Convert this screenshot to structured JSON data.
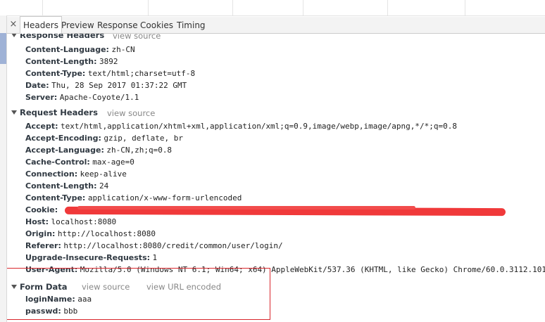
{
  "tabs": {
    "close": "×",
    "items": [
      "Headers",
      "Preview",
      "Response",
      "Cookies",
      "Timing"
    ],
    "active": "Headers"
  },
  "response_headers": {
    "title": "Response Headers",
    "view_source": "view source",
    "rows": [
      {
        "key": "Content-Language:",
        "value": "zh-CN"
      },
      {
        "key": "Content-Length:",
        "value": "3892"
      },
      {
        "key": "Content-Type:",
        "value": "text/html;charset=utf-8"
      },
      {
        "key": "Date:",
        "value": "Thu, 28 Sep 2017 01:37:22 GMT"
      },
      {
        "key": "Server:",
        "value": "Apache-Coyote/1.1"
      }
    ]
  },
  "request_headers": {
    "title": "Request Headers",
    "view_source": "view source",
    "rows": [
      {
        "key": "Accept:",
        "value": "text/html,application/xhtml+xml,application/xml;q=0.9,image/webp,image/apng,*/*;q=0.8"
      },
      {
        "key": "Accept-Encoding:",
        "value": "gzip, deflate, br"
      },
      {
        "key": "Accept-Language:",
        "value": "zh-CN,zh;q=0.8"
      },
      {
        "key": "Cache-Control:",
        "value": "max-age=0"
      },
      {
        "key": "Connection:",
        "value": "keep-alive"
      },
      {
        "key": "Content-Length:",
        "value": "24"
      },
      {
        "key": "Content-Type:",
        "value": "application/x-www-form-urlencoded"
      },
      {
        "key": "Cookie:",
        "value": ""
      },
      {
        "key": "Host:",
        "value": "localhost:8080"
      },
      {
        "key": "Origin:",
        "value": "http://localhost:8080"
      },
      {
        "key": "Referer:",
        "value": "http://localhost:8080/credit/common/user/login/"
      },
      {
        "key": "Upgrade-Insecure-Requests:",
        "value": "1"
      },
      {
        "key": "User-Agent:",
        "value": "Mozilla/5.0 (Windows NT 6.1; Win64; x64) AppleWebKit/537.36 (KHTML, like Gecko) Chrome/60.0.3112.101"
      }
    ]
  },
  "form_data": {
    "title": "Form Data",
    "view_source": "view source",
    "view_url_encoded": "view URL encoded",
    "rows": [
      {
        "key": "loginName:",
        "value": "aaa"
      },
      {
        "key": "passwd:",
        "value": "bbb"
      }
    ]
  },
  "colors": {
    "redaction": "#f0393a",
    "highlight_border": "#d9262c",
    "link": "#888888"
  }
}
